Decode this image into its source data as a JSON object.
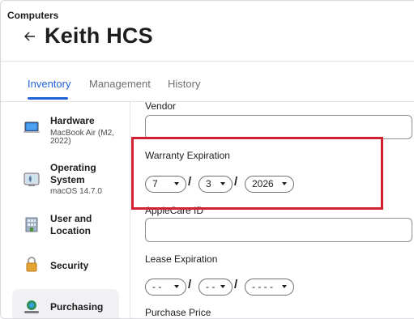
{
  "header": {
    "breadcrumb": "Computers",
    "title": "Keith HCS"
  },
  "tabs": [
    {
      "label": "Inventory",
      "active": true
    },
    {
      "label": "Management",
      "active": false
    },
    {
      "label": "History",
      "active": false
    }
  ],
  "sidebar": {
    "items": [
      {
        "label": "Hardware",
        "sub": "MacBook Air (M2, 2022)",
        "icon": "laptop-icon"
      },
      {
        "label": "Operating System",
        "sub": "macOS 14.7.0",
        "icon": "operating-system-icon"
      },
      {
        "label": "User and Location",
        "sub": "",
        "icon": "building-icon"
      },
      {
        "label": "Security",
        "sub": "",
        "icon": "lock-icon"
      },
      {
        "label": "Purchasing",
        "sub": "",
        "icon": "purchasing-icon",
        "selected": true
      }
    ]
  },
  "form": {
    "vendor_label": "Vendor",
    "vendor_value": "",
    "warranty_label": "Warranty Expiration",
    "warranty_month": "7",
    "warranty_day": "3",
    "warranty_year": "2026",
    "applecare_label": "AppleCare ID",
    "applecare_value": "",
    "lease_label": "Lease Expiration",
    "lease_month": "- -",
    "lease_day": "- -",
    "lease_year": "- - - -",
    "price_label": "Purchase Price",
    "date_separator": "/"
  },
  "colors": {
    "accent": "#1f63d6",
    "highlight": "#d32030"
  }
}
